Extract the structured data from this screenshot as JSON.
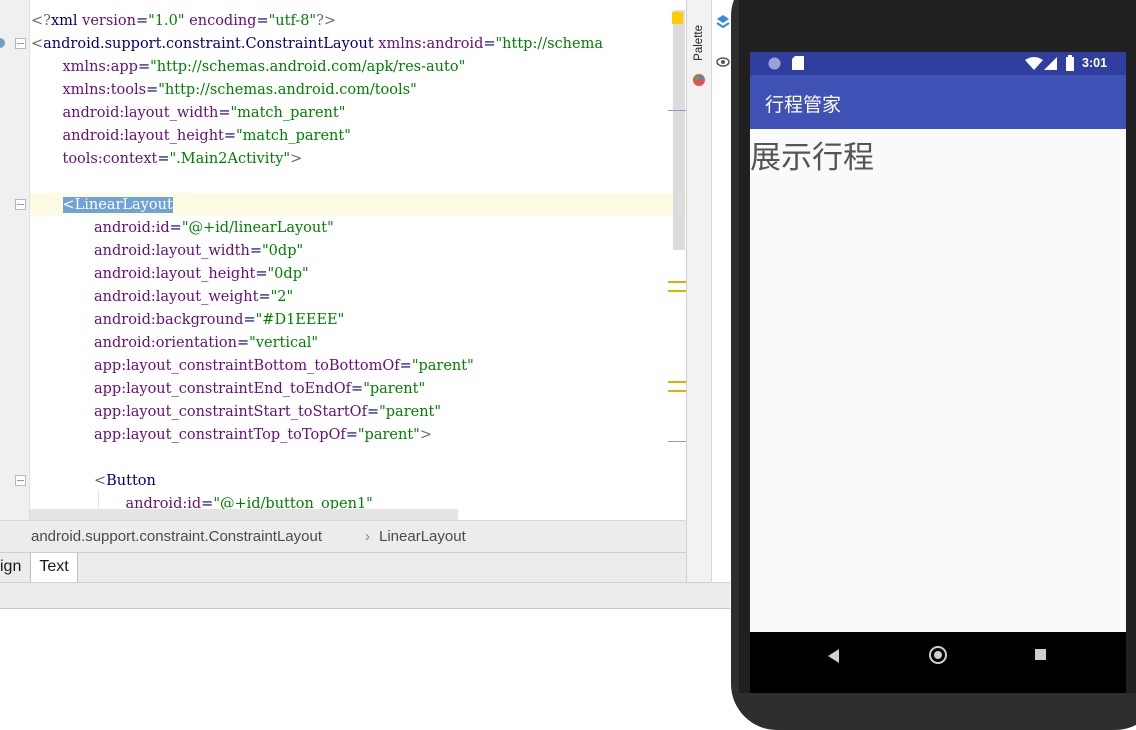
{
  "editor": {
    "lines": [
      {
        "row": 0,
        "indent": 0,
        "parts": [
          [
            "br",
            "<?"
          ],
          [
            "tag",
            "xml "
          ],
          [
            "attr",
            "version"
          ],
          [
            "tag",
            "="
          ],
          [
            "val",
            "\"1.0\""
          ],
          [
            "tag",
            " "
          ],
          [
            "attr",
            "encoding"
          ],
          [
            "tag",
            "="
          ],
          [
            "val",
            "\"utf-8\""
          ],
          [
            "br",
            "?>"
          ]
        ]
      },
      {
        "row": 1,
        "indent": 0,
        "parts": [
          [
            "br",
            "<"
          ],
          [
            "tag",
            "android.support.constraint.ConstraintLayout "
          ],
          [
            "ns",
            "xmlns:android"
          ],
          [
            "tag",
            "="
          ],
          [
            "val",
            "\"http://schema"
          ]
        ]
      },
      {
        "row": 2,
        "indent": 1,
        "parts": [
          [
            "ns",
            "xmlns:app"
          ],
          [
            "tag",
            "="
          ],
          [
            "val",
            "\"http://schemas.android.com/apk/res-auto\""
          ]
        ]
      },
      {
        "row": 3,
        "indent": 1,
        "parts": [
          [
            "ns",
            "xmlns:tools"
          ],
          [
            "tag",
            "="
          ],
          [
            "val",
            "\"http://schemas.android.com/tools\""
          ]
        ]
      },
      {
        "row": 4,
        "indent": 1,
        "parts": [
          [
            "attr",
            "android:layout_width"
          ],
          [
            "tag",
            "="
          ],
          [
            "val",
            "\"match_parent\""
          ]
        ]
      },
      {
        "row": 5,
        "indent": 1,
        "parts": [
          [
            "attr",
            "android:layout_height"
          ],
          [
            "tag",
            "="
          ],
          [
            "val",
            "\"match_parent\""
          ]
        ]
      },
      {
        "row": 6,
        "indent": 1,
        "parts": [
          [
            "attr",
            "tools:context"
          ],
          [
            "tag",
            "="
          ],
          [
            "val",
            "\".Main2Activity\""
          ],
          [
            "br",
            ">"
          ]
        ]
      },
      {
        "row": 8,
        "indent": 1,
        "parts": [
          [
            "sel",
            "<LinearLayout"
          ]
        ]
      },
      {
        "row": 9,
        "indent": 2,
        "parts": [
          [
            "attr",
            "android:id"
          ],
          [
            "tag",
            "="
          ],
          [
            "val",
            "\"@+id/linearLayout\""
          ]
        ]
      },
      {
        "row": 10,
        "indent": 2,
        "parts": [
          [
            "attr",
            "android:layout_width"
          ],
          [
            "tag",
            "="
          ],
          [
            "val",
            "\"0dp\""
          ]
        ]
      },
      {
        "row": 11,
        "indent": 2,
        "parts": [
          [
            "attr",
            "android:layout_height"
          ],
          [
            "tag",
            "="
          ],
          [
            "val",
            "\"0dp\""
          ]
        ]
      },
      {
        "row": 12,
        "indent": 2,
        "parts": [
          [
            "attr",
            "android:layout_weight"
          ],
          [
            "tag",
            "="
          ],
          [
            "val",
            "\"2\""
          ]
        ]
      },
      {
        "row": 13,
        "indent": 2,
        "parts": [
          [
            "attr",
            "android:background"
          ],
          [
            "tag",
            "="
          ],
          [
            "val",
            "\"#D1EEEE\""
          ]
        ]
      },
      {
        "row": 14,
        "indent": 2,
        "parts": [
          [
            "attr",
            "android:orientation"
          ],
          [
            "tag",
            "="
          ],
          [
            "val",
            "\"vertical\""
          ]
        ]
      },
      {
        "row": 15,
        "indent": 2,
        "parts": [
          [
            "attr",
            "app:layout_constraintBottom_toBottomOf"
          ],
          [
            "tag",
            "="
          ],
          [
            "val",
            "\"parent\""
          ]
        ]
      },
      {
        "row": 16,
        "indent": 2,
        "parts": [
          [
            "attr",
            "app:layout_constraintEnd_toEndOf"
          ],
          [
            "tag",
            "="
          ],
          [
            "val",
            "\"parent\""
          ]
        ]
      },
      {
        "row": 17,
        "indent": 2,
        "parts": [
          [
            "attr",
            "app:layout_constraintStart_toStartOf"
          ],
          [
            "tag",
            "="
          ],
          [
            "val",
            "\"parent\""
          ]
        ]
      },
      {
        "row": 18,
        "indent": 2,
        "parts": [
          [
            "attr",
            "app:layout_constraintTop_toTopOf"
          ],
          [
            "tag",
            "="
          ],
          [
            "val",
            "\"parent\""
          ],
          [
            "br",
            ">"
          ]
        ]
      },
      {
        "row": 20,
        "indent": 2,
        "parts": [
          [
            "br",
            "<"
          ],
          [
            "tag",
            "Button"
          ]
        ]
      },
      {
        "row": 21,
        "indent": 3,
        "parts": [
          [
            "attr",
            "android:id"
          ],
          [
            "tag",
            "="
          ],
          [
            "val",
            "\"@+id/button_open1\""
          ]
        ]
      }
    ]
  },
  "breadcrumb": {
    "item1": "android.support.constraint.ConstraintLayout",
    "separator": "›",
    "item2": "LinearLayout"
  },
  "tabs": {
    "design_partial": "ign",
    "text": "Text"
  },
  "side_panel": {
    "palette_label": "Palette"
  },
  "phone": {
    "status_time": "3:01",
    "app_title": "行程管家",
    "content_text": "展示行程"
  },
  "colors": {
    "status_bar": "#303f9f",
    "app_bar": "#3f51b5",
    "tag": "#000080",
    "attribute": "#660e7a",
    "value": "#008000"
  }
}
